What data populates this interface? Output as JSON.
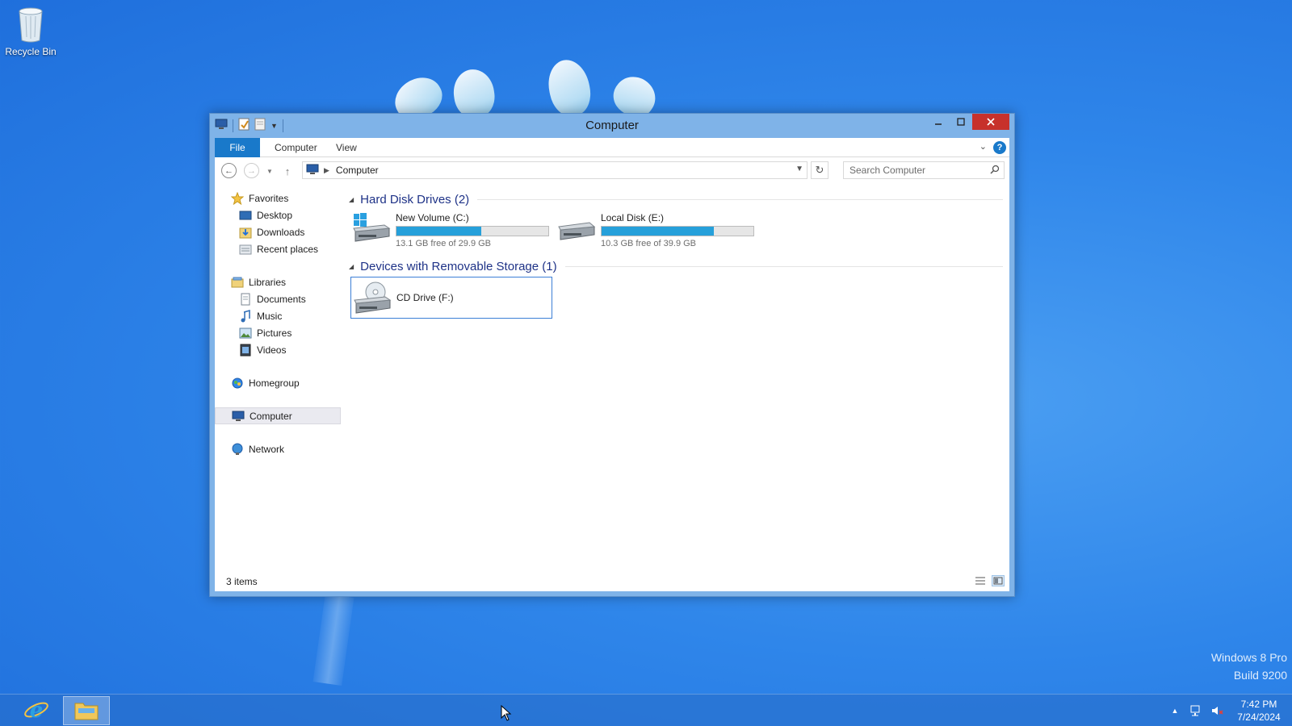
{
  "desktop": {
    "icons": [
      {
        "label": "Recycle Bin",
        "icon": "recycle-bin-icon"
      }
    ],
    "watermark": {
      "line1": "Windows 8 Pro",
      "line2": "Build 9200"
    }
  },
  "window": {
    "title": "Computer",
    "ribbon_tabs": [
      {
        "label": "File"
      },
      {
        "label": "Computer"
      },
      {
        "label": "View"
      }
    ],
    "address": {
      "crumb": "Computer"
    },
    "search": {
      "placeholder": "Search Computer"
    },
    "nav_pane": {
      "favorites": {
        "label": "Favorites",
        "items": [
          {
            "label": "Desktop"
          },
          {
            "label": "Downloads"
          },
          {
            "label": "Recent places"
          }
        ]
      },
      "libraries": {
        "label": "Libraries",
        "items": [
          {
            "label": "Documents"
          },
          {
            "label": "Music"
          },
          {
            "label": "Pictures"
          },
          {
            "label": "Videos"
          }
        ]
      },
      "homegroup": {
        "label": "Homegroup"
      },
      "computer": {
        "label": "Computer"
      },
      "network": {
        "label": "Network"
      }
    },
    "groups": {
      "hard_disks": {
        "title": "Hard Disk Drives (2)",
        "drives": [
          {
            "name": "New Volume (C:)",
            "free_text": "13.1 GB free of 29.9 GB",
            "used_fraction": 0.56
          },
          {
            "name": "Local Disk (E:)",
            "free_text": "10.3 GB free of 39.9 GB",
            "used_fraction": 0.74
          }
        ]
      },
      "removable": {
        "title": "Devices with Removable Storage (1)",
        "drives": [
          {
            "name": "CD Drive (F:)"
          }
        ]
      }
    },
    "status": {
      "items_text": "3 items"
    }
  },
  "taskbar": {
    "clock": {
      "time": "7:42 PM",
      "date": "7/24/2024"
    }
  },
  "colors": {
    "accent": "#1979ca",
    "drive_bar": "#26a0da",
    "close_button": "#c7312b",
    "group_header": "#1e3287"
  }
}
